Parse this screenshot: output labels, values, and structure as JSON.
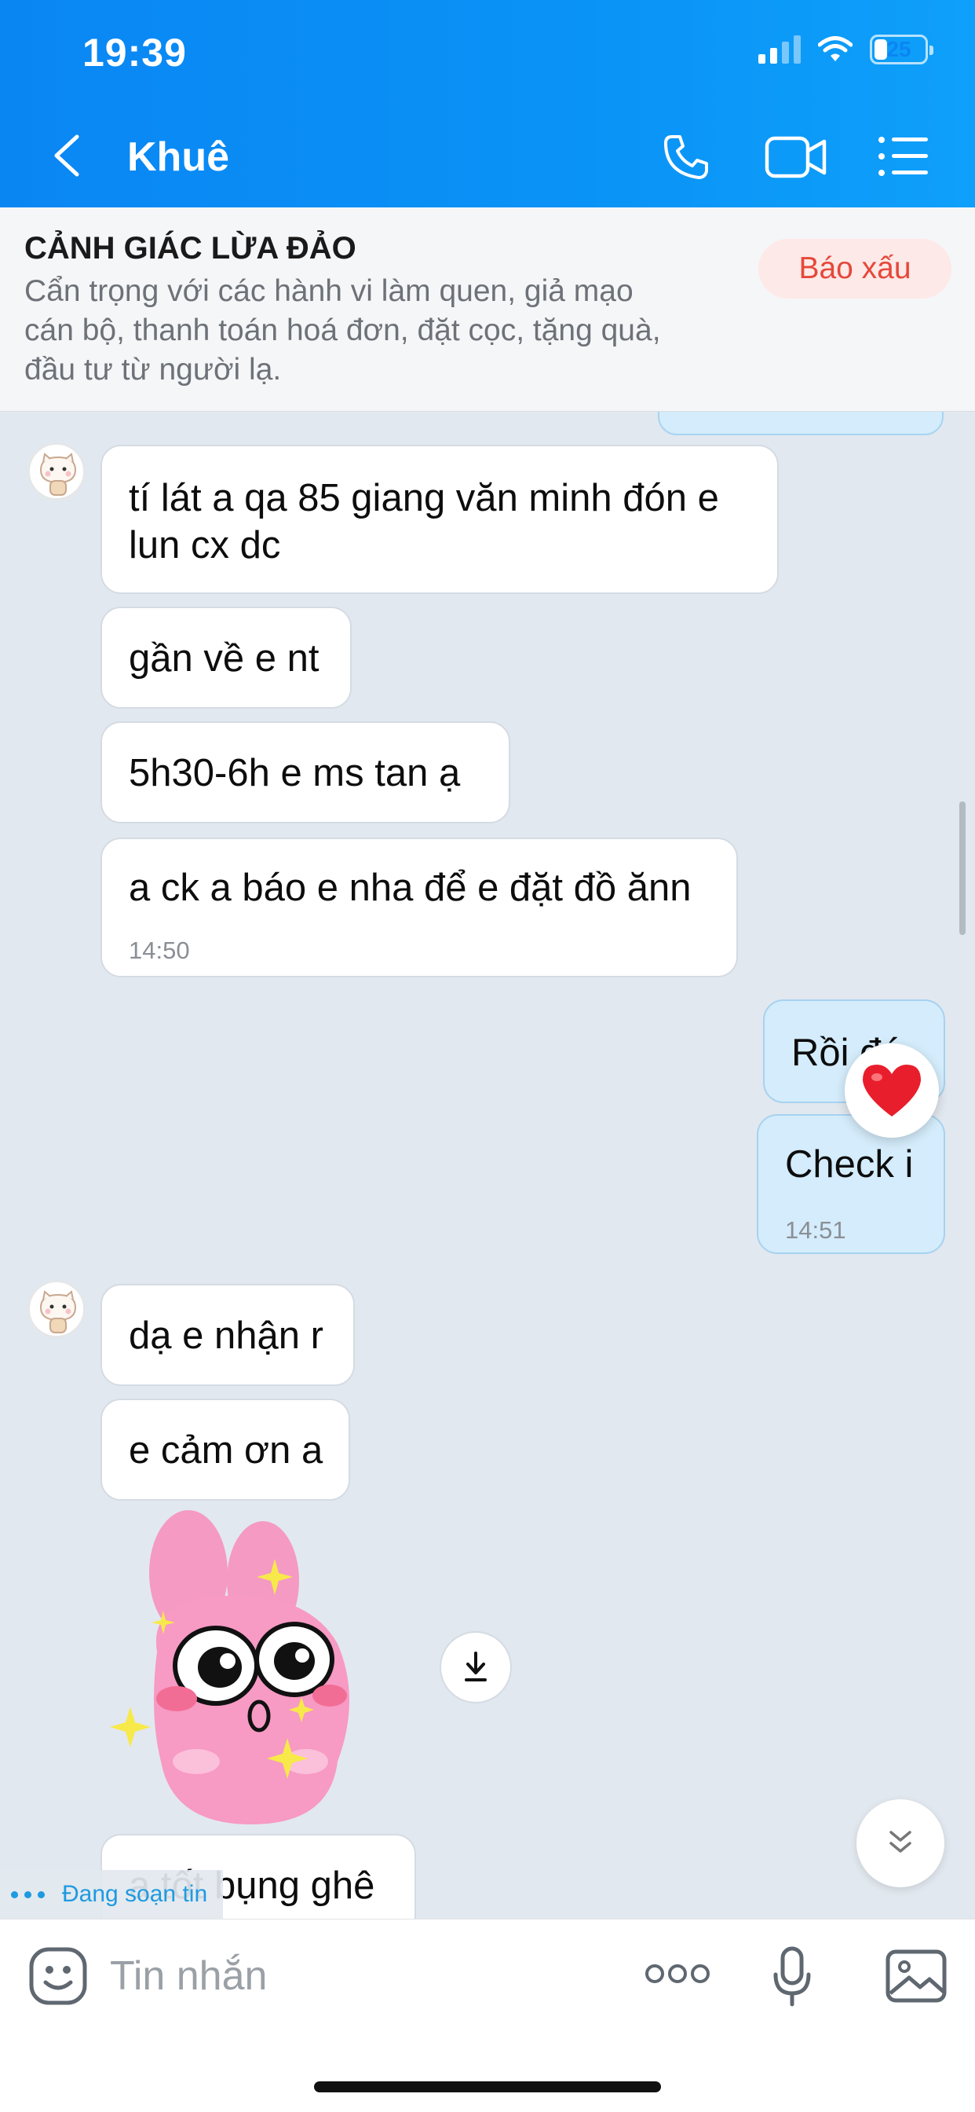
{
  "status_bar": {
    "time": "19:39",
    "battery": "25",
    "battery_level_percent": 25
  },
  "header": {
    "contact_name": "Khuê",
    "icons": [
      "back-icon",
      "phone-icon",
      "video-call-icon",
      "menu-list-icon"
    ]
  },
  "warning": {
    "title": "CẢNH GIÁC LỪA ĐẢO",
    "lines": [
      "Cẩn trọng với các hành vi làm quen, giả mạo",
      "cán bộ, thanh toán hoá đơn, đặt cọc, tặng quà,",
      "đầu tư từ người lạ."
    ],
    "report_label": "Báo xấu"
  },
  "messages": {
    "m1_line1": "tí lát a qa 85 giang văn minh đón e",
    "m1_line2": "lun cx dc",
    "m2": "gần về e nt",
    "m3": "5h30-6h e ms tan ạ",
    "m4": "a ck a báo e nha để e đặt đồ ănn",
    "m4_time": "14:50",
    "s1": "Rồi đó",
    "s2": "Check i",
    "s2_time": "14:51",
    "m5": "dạ e nhận r",
    "m6": "e cảm ơn a",
    "m7": "a tốt bụng ghê"
  },
  "reaction": "heart",
  "typing_indicator": "Đang soạn tin",
  "input": {
    "placeholder": "Tin nhắn"
  },
  "colors": {
    "header_blue": "#0a86f3",
    "sent_bubble": "#d4ecfb",
    "chat_background": "#e2e8ef",
    "report_red": "#e5483a"
  }
}
